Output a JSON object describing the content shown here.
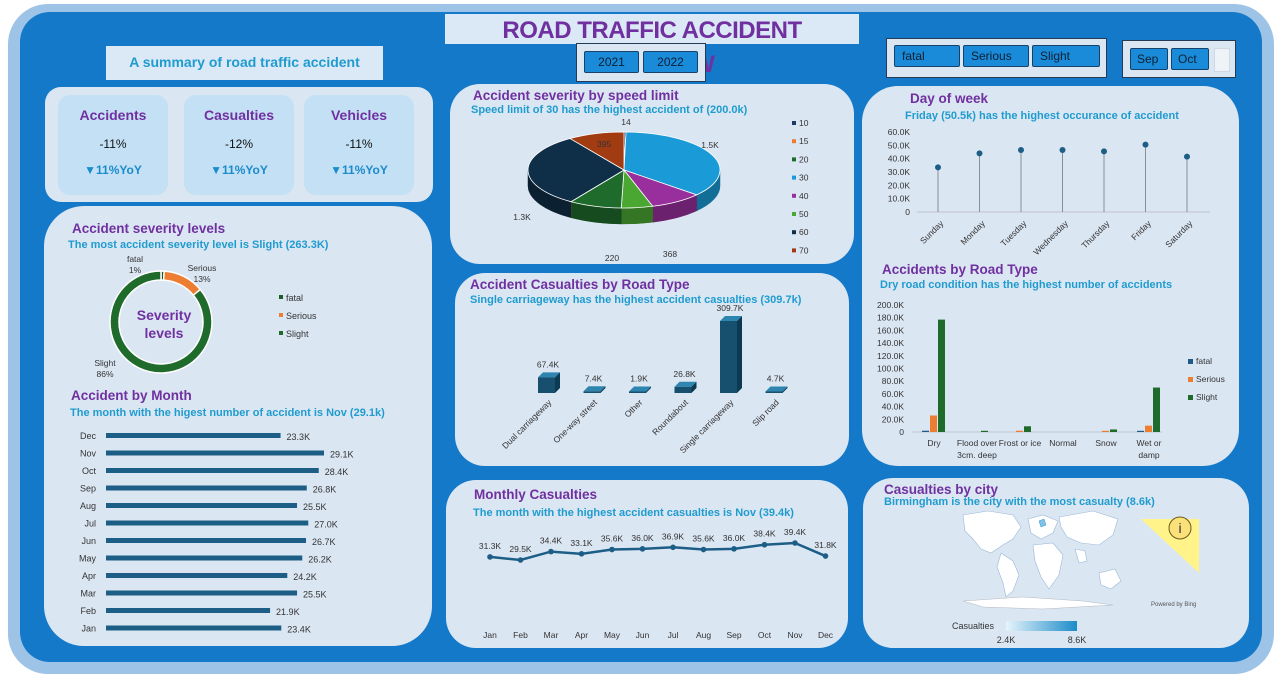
{
  "header": {
    "title": "ROAD TRAFFIC ACCIDENT OVERVIEW",
    "summary": "A summary of road traffic accident trends"
  },
  "filters": {
    "years": [
      "2021",
      "2022"
    ],
    "severity": [
      "fatal",
      "Serious",
      "Slight"
    ],
    "months": [
      "Sep",
      "Oct"
    ]
  },
  "kpis": [
    {
      "title": "Accidents",
      "value": "-11%",
      "yoy": "▼11%YoY"
    },
    {
      "title": "Casualties",
      "value": "-12%",
      "yoy": "▼11%YoY"
    },
    {
      "title": "Vehicles",
      "value": "-11%",
      "yoy": "▼11%YoY"
    }
  ],
  "severity_panel": {
    "title": "Accident severity levels",
    "subtitle": "The most accident severity level is Slight (263.3K)",
    "center_label_1": "Severity",
    "center_label_2": "levels"
  },
  "month_panel": {
    "title": "Accident by Month",
    "subtitle": "The month with the higest number of accident is Nov (29.1k)"
  },
  "speed_panel": {
    "title": "Accident severity by speed limit",
    "subtitle": "Speed limit of 30 has the highest accident of (200.0k)"
  },
  "roadtype_panel": {
    "title": "Accident Casualties by Road Type",
    "subtitle": "Single carriageway has the highest accident casualties  (309.7k)"
  },
  "monthly_cas_panel": {
    "title": "Monthly Casualties",
    "subtitle": "The month with the highest accident casualties is Nov (39.4k)"
  },
  "dow_panel": {
    "title": "Day of week",
    "subtitle": "Friday (50.5k) has the highest occurance of accident"
  },
  "road_cond_panel": {
    "title": "Accidents by Road Type",
    "subtitle": "Dry road condition has the highest number of accidents"
  },
  "city_panel": {
    "title": "Casualties by city",
    "subtitle": "Birmingham is the city with the most casualty (8.6k)",
    "powered": "Powered by Bing",
    "legend_title": "Casualties",
    "legend_min": "2.4K",
    "legend_max": "8.6K",
    "info_icon_text": "i"
  },
  "chart_data": [
    {
      "id": "severity-donut",
      "type": "pie",
      "categories": [
        "fatal",
        "Serious",
        "Slight"
      ],
      "values": [
        1,
        13,
        86
      ],
      "value_labels": [
        "1%",
        "13%",
        "86%"
      ],
      "colors": [
        "#1f5c2a",
        "#ed7d31",
        "#1e6b2b"
      ]
    },
    {
      "id": "accident-by-month",
      "type": "bar",
      "orientation": "horizontal",
      "categories": [
        "Dec",
        "Nov",
        "Oct",
        "Sep",
        "Aug",
        "Jul",
        "Jun",
        "May",
        "Apr",
        "Mar",
        "Feb",
        "Jan"
      ],
      "values": [
        23.3,
        29.1,
        28.4,
        26.8,
        25.5,
        27.0,
        26.7,
        26.2,
        24.2,
        25.5,
        21.9,
        23.4
      ],
      "value_labels": [
        "23.3K",
        "29.1K",
        "28.4K",
        "26.8K",
        "25.5K",
        "27.0K",
        "26.7K",
        "26.2K",
        "24.2K",
        "25.5K",
        "21.9K",
        "23.4K"
      ],
      "color": "#1c5e86"
    },
    {
      "id": "speed-limit-pie",
      "type": "pie",
      "categories": [
        "10",
        "15",
        "20",
        "30",
        "40",
        "50",
        "60",
        "70"
      ],
      "values": [
        0.014,
        0.001,
        0.368,
        1.5,
        0.368,
        0.22,
        1.3,
        0.395
      ],
      "value_labels": [
        "14",
        "",
        "368",
        "1.5K",
        "368",
        "220",
        "1.3K",
        "395"
      ],
      "colors": [
        "#1f3864",
        "#ed7d31",
        "#1e6b2b",
        "#1a9bd7",
        "#992f9c",
        "#4aa832",
        "#0f2f48",
        "#a13c12"
      ]
    },
    {
      "id": "road-type-casualties",
      "type": "bar",
      "categories": [
        "Dual carriageway",
        "One-way street",
        "Other",
        "Roundabout",
        "Single carriageway",
        "Slip road"
      ],
      "values": [
        67.4,
        7.4,
        1.9,
        26.8,
        309.7,
        4.7
      ],
      "value_labels": [
        "67.4K",
        "7.4K",
        "1.9K",
        "26.8K",
        "309.7K",
        "4.7K"
      ],
      "color": "#16506e"
    },
    {
      "id": "monthly-casualties",
      "type": "line",
      "categories": [
        "Jan",
        "Feb",
        "Mar",
        "Apr",
        "May",
        "Jun",
        "Jul",
        "Aug",
        "Sep",
        "Oct",
        "Nov",
        "Dec"
      ],
      "values": [
        31.3,
        29.5,
        34.4,
        33.1,
        35.6,
        36.0,
        36.9,
        35.6,
        36.0,
        38.4,
        39.4,
        31.8
      ],
      "value_labels": [
        "31.3K",
        "29.5K",
        "34.4K",
        "33.1K",
        "35.6K",
        "36.0K",
        "36.9K",
        "35.6K",
        "36.0K",
        "38.4K",
        "39.4K",
        "31.8K"
      ],
      "color": "#1c5e86"
    },
    {
      "id": "day-of-week",
      "type": "scatter",
      "categories": [
        "Sunday",
        "Monday",
        "Tuesday",
        "Wednesday",
        "Thursday",
        "Friday",
        "Saturday"
      ],
      "values": [
        33.5,
        44.0,
        46.5,
        46.5,
        45.5,
        50.5,
        41.5
      ],
      "yticks": [
        "0",
        "10.0K",
        "20.0K",
        "30.0K",
        "40.0K",
        "50.0K",
        "60.0K"
      ],
      "ylim": [
        0,
        60
      ],
      "color": "#1c5e86"
    },
    {
      "id": "road-condition",
      "type": "bar",
      "categories": [
        "Dry",
        "Flood over 3cm. deep",
        "Frost or ice",
        "Normal",
        "Snow",
        "Wet or damp"
      ],
      "category_lines": [
        [
          "Dry"
        ],
        [
          "Flood over",
          "3cm. deep"
        ],
        [
          "Frost or ice"
        ],
        [
          "Normal"
        ],
        [
          "Snow"
        ],
        [
          "Wet or",
          "damp"
        ]
      ],
      "series": [
        {
          "name": "fatal",
          "values": [
            2,
            0,
            0,
            0,
            0,
            1
          ],
          "color": "#1f5a8a"
        },
        {
          "name": "Serious",
          "values": [
            26,
            0,
            2,
            0,
            1,
            10
          ],
          "color": "#ed7d31"
        },
        {
          "name": "Slight",
          "values": [
            177,
            1,
            9,
            0,
            4,
            70
          ],
          "color": "#1e6b2b"
        }
      ],
      "yticks": [
        "0",
        "20.0K",
        "40.0K",
        "60.0K",
        "80.0K",
        "100.0K",
        "120.0K",
        "140.0K",
        "160.0K",
        "180.0K",
        "200.0K"
      ],
      "ylim": [
        0,
        200
      ]
    }
  ]
}
